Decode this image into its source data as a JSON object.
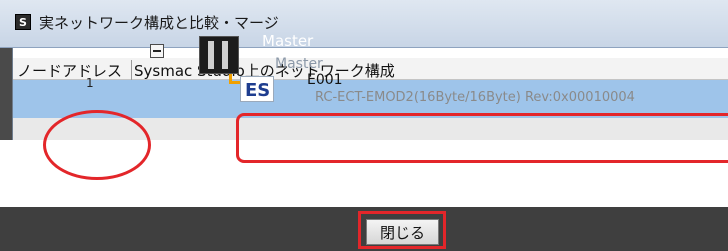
{
  "dialog": {
    "title": "実ネットワーク構成と比較・マージ",
    "app_icon_glyph": "S"
  },
  "table": {
    "col_node_address": "ノードアドレス",
    "col_sysmac_network": "Sysmac Studio上のネットワーク構成",
    "master": {
      "label": "Master",
      "sublabel": "Master"
    },
    "slave": {
      "node_address": "1",
      "name": "E001",
      "description": "RC-ECT-EMOD2(16Byte/16Byte) Rev:0x00010004"
    }
  },
  "footer": {
    "close_label": "閉じる"
  },
  "colors": {
    "highlight_red": "#e3262a",
    "master_row_bg": "#9ec4ea",
    "tree_connector": "#f0a000"
  }
}
